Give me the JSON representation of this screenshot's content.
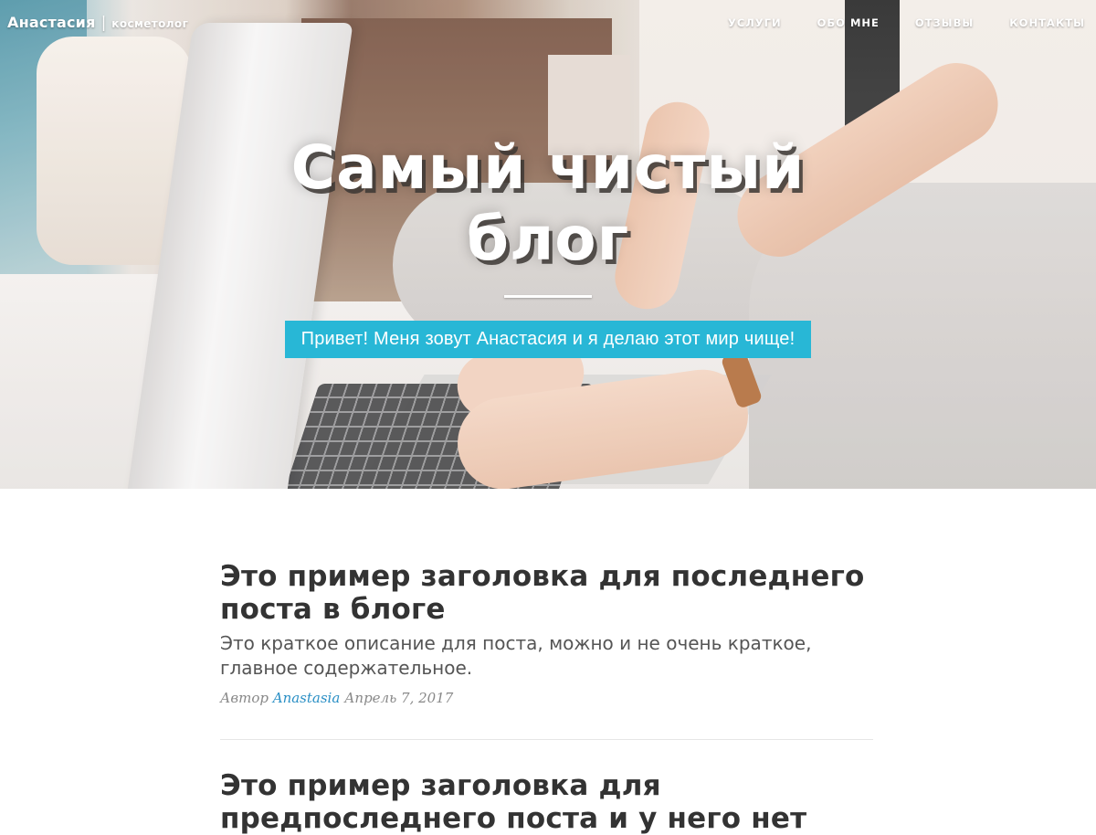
{
  "nav": {
    "brand_name": "Анастасия",
    "brand_separator": "|",
    "brand_role": "косметолог",
    "links": [
      {
        "label": "УСЛУГИ"
      },
      {
        "label": "ОБО МНЕ"
      },
      {
        "label": "ОТЗЫВЫ"
      },
      {
        "label": "КОНТАКТЫ"
      }
    ]
  },
  "hero": {
    "title": "Самый чистый блог",
    "subtitle": "Привет! Меня зовут Анастасия и я делаю этот мир чище!",
    "subtitle_bg": "#28b7d6"
  },
  "posts": [
    {
      "title": "Это пример заголовка для последнего поста в блоге",
      "subtitle": "Это краткое описание для поста, можно и не очень краткое, главное содержательное.",
      "meta_prefix": "Автор",
      "author": "Anastasia",
      "date": "Апрель 7, 2017"
    },
    {
      "title": "Это пример заголовка для предпоследнего поста и у него нет"
    }
  ],
  "colors": {
    "accent": "#28b7d6",
    "link": "#2a8fc5",
    "heading": "#333333"
  }
}
